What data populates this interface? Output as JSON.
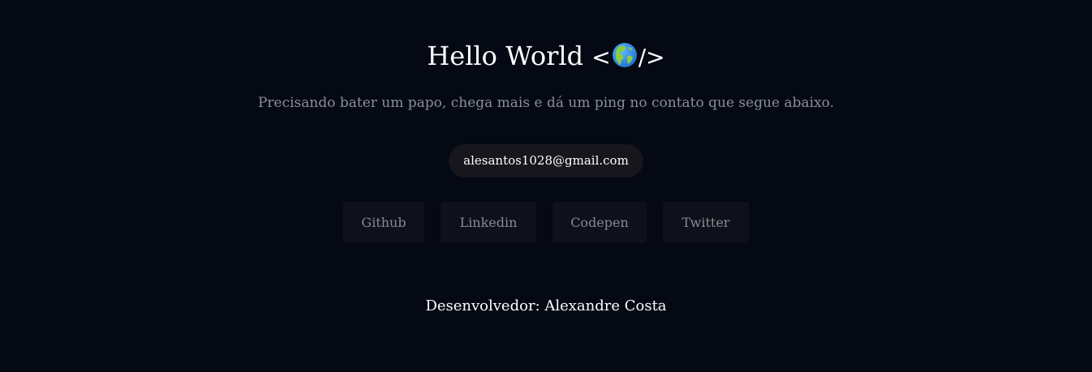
{
  "hero": {
    "title": "Hello World",
    "tag_open": "<",
    "tag_close": "/>",
    "globe_icon": "globe-americas-icon"
  },
  "intro": {
    "text": "Precisando bater um papo, chega mais e dá um ping no contato que segue abaixo."
  },
  "contact": {
    "email": "alesantos1028@gmail.com"
  },
  "social": [
    {
      "label": "Github"
    },
    {
      "label": "Linkedin"
    },
    {
      "label": "Codepen"
    },
    {
      "label": "Twitter"
    }
  ],
  "footer": {
    "credit": "Desenvolvedor: Alexandre Costa"
  },
  "colors": {
    "background": "#040914",
    "pill_background": "#17161c",
    "button_background": "#0e1119",
    "muted_text": "#8b8f98"
  }
}
